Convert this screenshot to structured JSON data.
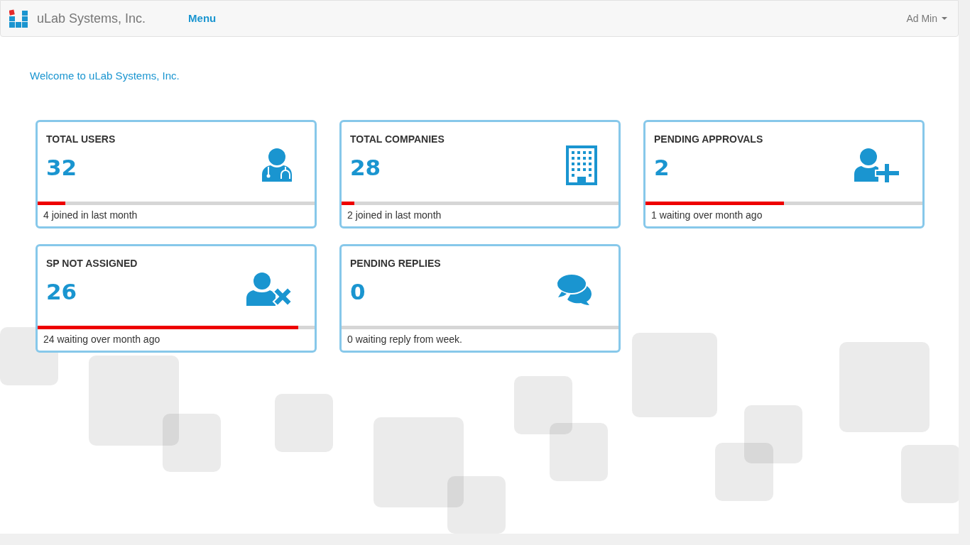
{
  "navbar": {
    "brand": "uLab Systems, Inc.",
    "menu": "Menu",
    "user": "Ad Min"
  },
  "welcome": "Welcome to uLab Systems, Inc.",
  "cards": [
    {
      "kind": "users",
      "title": "TOTAL USERS",
      "value": "32",
      "level": 0.1,
      "footer": "4 joined in last month"
    },
    {
      "kind": "companies",
      "title": "TOTAL COMPANIES",
      "value": "28",
      "level": 0.045,
      "footer": "2 joined in last month"
    },
    {
      "kind": "approvals",
      "title": "PENDING APPROVALS",
      "value": "2",
      "level": 0.5,
      "footer": "1 waiting over month ago"
    },
    {
      "kind": "unassigned",
      "title": "SP NOT ASSIGNED",
      "value": "26",
      "level": 0.94,
      "footer": "24 waiting over month ago"
    },
    {
      "kind": "replies",
      "title": "PENDING REPLIES",
      "value": "0",
      "level": 0,
      "footer": "0 waiting reply from week."
    }
  ]
}
